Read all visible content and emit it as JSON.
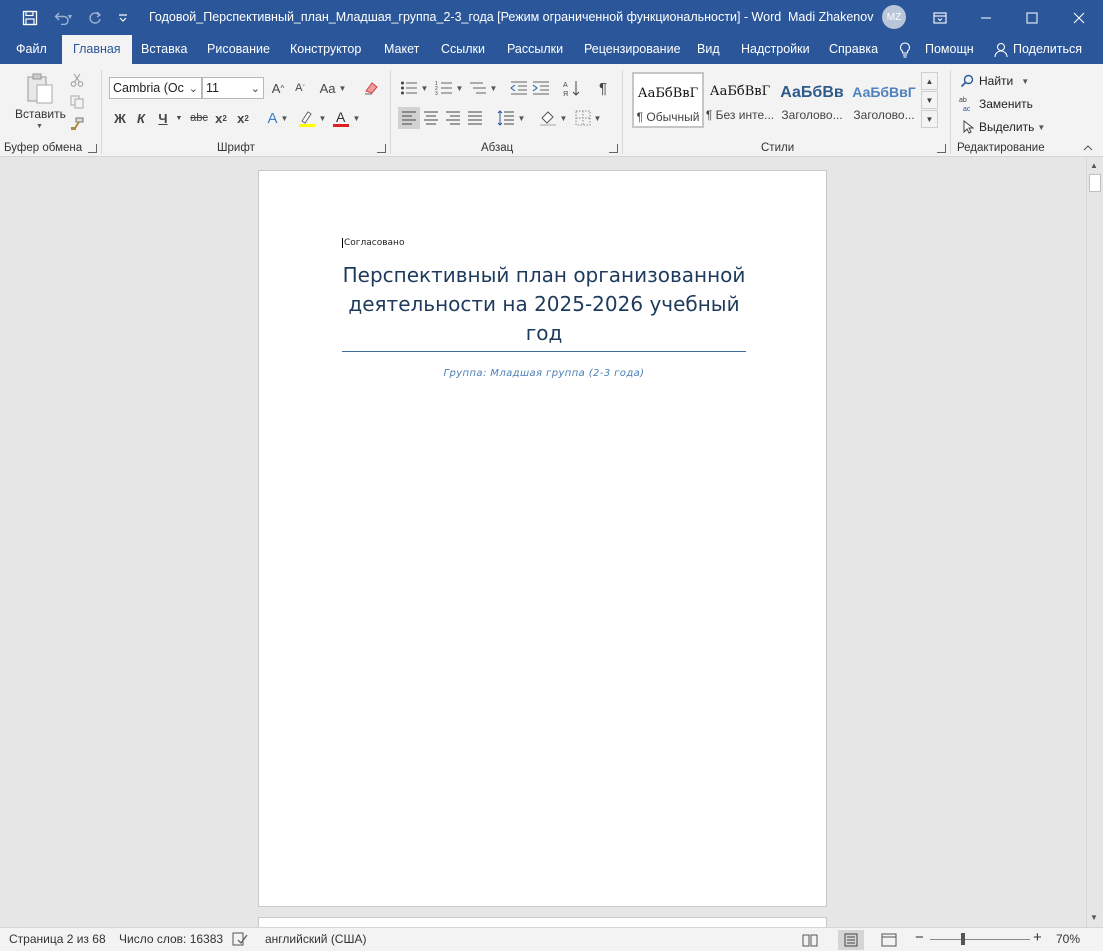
{
  "window": {
    "title": "Годовой_Перспективный_план_Младшая_группа_2-3_года [Режим ограниченной функциональности]  -  Word",
    "user_name": "Madi Zhakenov",
    "user_initials": "MZ"
  },
  "tabs": [
    {
      "label": "Файл"
    },
    {
      "label": "Главная"
    },
    {
      "label": "Вставка"
    },
    {
      "label": "Рисование"
    },
    {
      "label": "Конструктор"
    },
    {
      "label": "Макет"
    },
    {
      "label": "Ссылки"
    },
    {
      "label": "Рассылки"
    },
    {
      "label": "Рецензирование"
    },
    {
      "label": "Вид"
    },
    {
      "label": "Надстройки"
    },
    {
      "label": "Справка"
    },
    {
      "label": "Помощн"
    },
    {
      "label": "Поделиться"
    }
  ],
  "ribbon": {
    "clipboard": {
      "paste_label": "Вставить",
      "group_label": "Буфер обмена"
    },
    "font": {
      "font_name": "Cambria (Ос",
      "font_size": "11",
      "change_case": "Aa",
      "bold": "Ж",
      "italic": "К",
      "underline": "Ч",
      "strike": "abc",
      "group_label": "Шрифт"
    },
    "paragraph": {
      "group_label": "Абзац"
    },
    "styles": {
      "group_label": "Стили",
      "items": [
        {
          "sample": "АаБбВвГ",
          "name": "¶ Обычный"
        },
        {
          "sample": "АаБбВвГ",
          "name": "¶ Без инте..."
        },
        {
          "sample": "АаБбВв",
          "name": "Заголово..."
        },
        {
          "sample": "АаБбВвГ",
          "name": "Заголово..."
        }
      ]
    },
    "editing": {
      "find": "Найти",
      "replace": "Заменить",
      "select": "Выделить",
      "group_label": "Редактирование"
    }
  },
  "document": {
    "approved": "Согласовано",
    "title": "Перспективный план организованной деятельности на 2025-2026 учебный год",
    "group_line": "Группа: Младшая группа (2-3 года)"
  },
  "status": {
    "page": "Страница 2 из 68",
    "words": "Число слов: 16383",
    "language": "английский (США)",
    "zoom": "70%"
  },
  "colors": {
    "accent": "#2b579a",
    "title_text": "#1f3b5c",
    "subtitle_text": "#4a7fb5"
  }
}
